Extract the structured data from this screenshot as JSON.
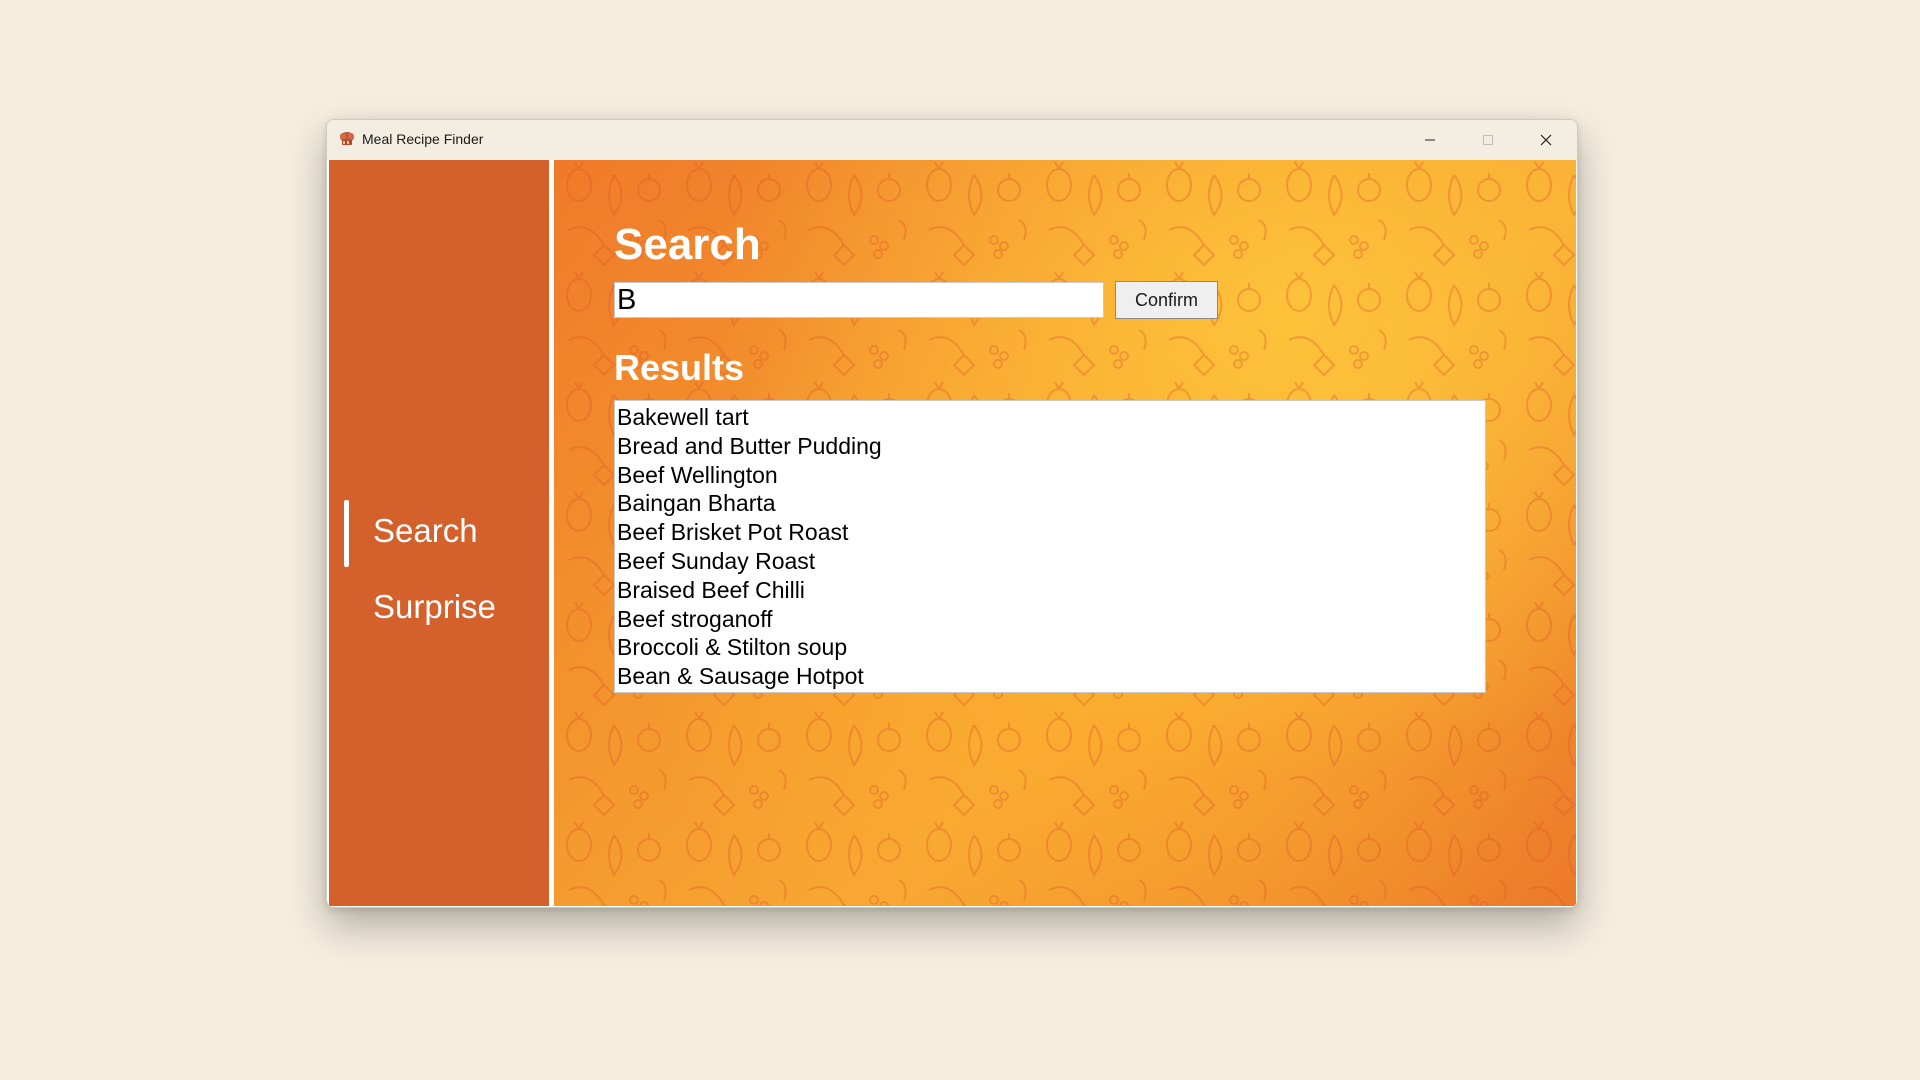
{
  "window": {
    "title": "Meal Recipe Finder",
    "icon": "chef-hat-icon",
    "controls": [
      "minimize-icon",
      "maximize-icon",
      "close-icon"
    ]
  },
  "sidebar": {
    "items": [
      {
        "label": "Search",
        "active": true
      },
      {
        "label": "Surprise",
        "active": false
      }
    ],
    "background": "#d4602c"
  },
  "main": {
    "search_heading": "Search",
    "search_value": "B",
    "confirm_label": "Confirm",
    "results_heading": "Results",
    "results": [
      "Bakewell tart",
      "Bread and Butter Pudding",
      "Beef Wellington",
      "Baingan Bharta",
      "Beef Brisket Pot Roast",
      "Beef Sunday Roast",
      "Braised Beef Chilli",
      "Beef stroganoff",
      "Broccoli & Stilton soup",
      "Bean & Sausage Hotpot"
    ],
    "accent_colors": [
      "#ef7a2a",
      "#f7a733"
    ]
  }
}
